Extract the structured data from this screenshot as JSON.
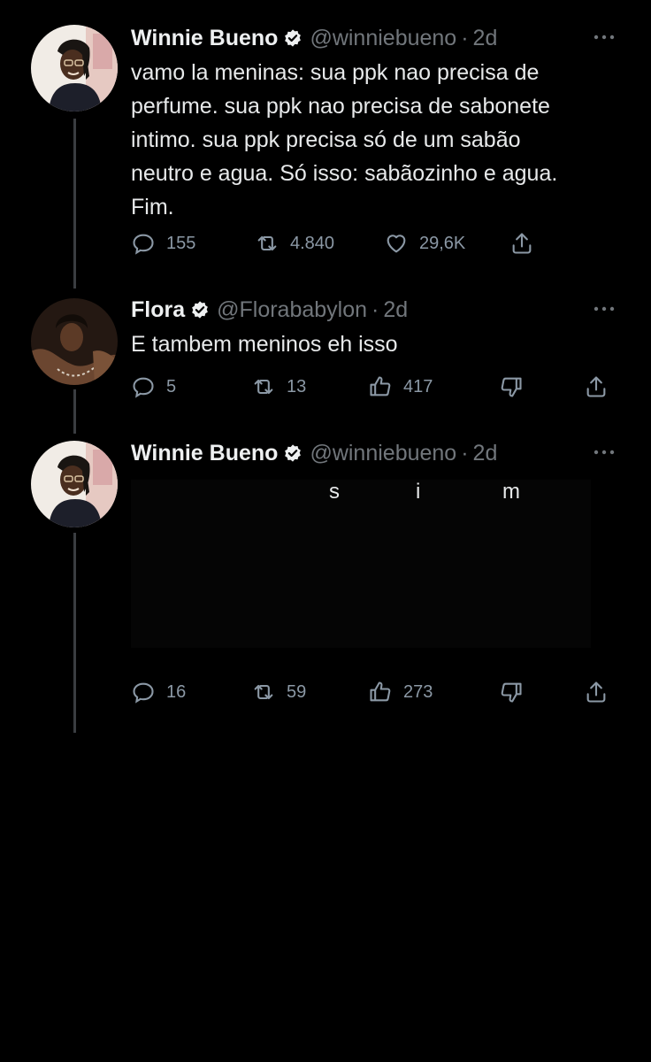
{
  "tweets": [
    {
      "name": "Winnie Bueno",
      "handle": "@winniebueno",
      "separator": "·",
      "time": "2d",
      "text": "vamo la meninas: sua ppk nao precisa de\nperfume. sua ppk nao precisa de sabonete\nintimo. sua ppk precisa só de um sabão\nneutro e agua. Só isso: sabãozinho e agua.\nFim.",
      "replies": "155",
      "retweets": "4.840",
      "likes": "29,6K"
    },
    {
      "name": "Flora",
      "handle": "@Florababylon",
      "separator": "·",
      "time": "2d",
      "text": "E tambem meninos eh isso",
      "replies": "5",
      "retweets": "13",
      "likes": "417"
    },
    {
      "name": "Winnie Bueno",
      "handle": "@winniebueno",
      "separator": "·",
      "time": "2d",
      "visible_fragments": [
        "s",
        "i",
        "m"
      ],
      "replies": "16",
      "retweets": "59",
      "likes": "273"
    }
  ],
  "icons": {
    "verified": "verified-badge-icon",
    "more": "more-options-icon",
    "reply": "reply-icon",
    "retweet": "retweet-icon",
    "like": "heart-icon",
    "upvote": "thumbs-up-icon",
    "downvote": "thumbs-down-icon",
    "share": "share-icon"
  },
  "colors": {
    "background": "#000000",
    "text": "#e7e9ea",
    "secondary": "#71767b",
    "thread_line": "#3a3d41"
  }
}
